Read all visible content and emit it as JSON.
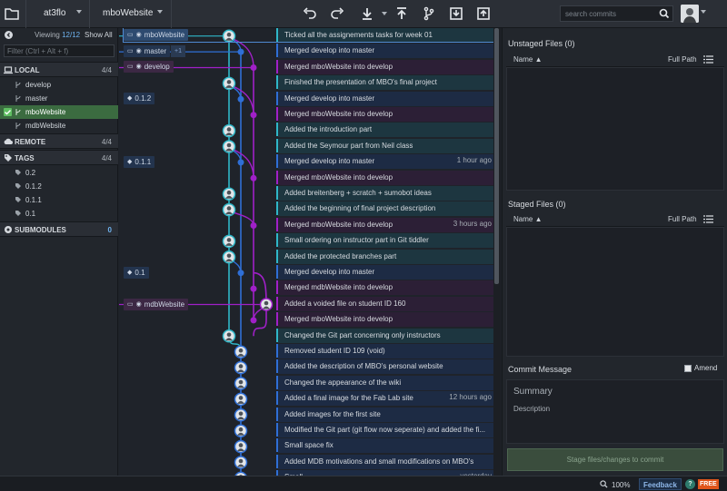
{
  "toolbar": {
    "repo_owner": "at3flo",
    "repo_name": "mboWebsite",
    "search_placeholder": "search commits",
    "actions": [
      "undo",
      "redo",
      "pull",
      "push",
      "branch",
      "stash",
      "pop"
    ]
  },
  "left_panel": {
    "viewing_label": "Viewing",
    "viewing_count": "12/12",
    "show_all": "Show All",
    "filter_placeholder": "Filter (Ctrl + Alt + f)",
    "local": {
      "label": "LOCAL",
      "count": "4/4",
      "items": [
        "develop",
        "master",
        "mboWebsite",
        "mdbWebsite"
      ],
      "active_index": 2
    },
    "remote": {
      "label": "REMOTE",
      "count": "4/4"
    },
    "tags": {
      "label": "TAGS",
      "count": "4/4",
      "items": [
        "0.2",
        "0.1.2",
        "0.1.1",
        "0.1"
      ]
    },
    "submodules": {
      "label": "SUBMODULES",
      "count": "0"
    }
  },
  "graph": {
    "branch_labels": {
      "mboWebsite": "mboWebsite",
      "master": "master",
      "master_extra": "+1",
      "develop": "develop",
      "tag_012": "0.1.2",
      "tag_011": "0.1.1",
      "tag_01": "0.1",
      "mdbWebsite": "mdbWebsite"
    },
    "commits": [
      {
        "msg": "Ticked all the assignements tasks for week 01",
        "time": ""
      },
      {
        "msg": "Merged develop into master",
        "time": ""
      },
      {
        "msg": "Merged mboWebsite into develop",
        "time": ""
      },
      {
        "msg": "Finished the presentation of MBO's final project",
        "time": ""
      },
      {
        "msg": "Merged develop into master",
        "time": ""
      },
      {
        "msg": "Merged mboWebsite into develop",
        "time": ""
      },
      {
        "msg": "Added the introduction part",
        "time": ""
      },
      {
        "msg": "Added the Seymour part from Neil class",
        "time": ""
      },
      {
        "msg": "Merged develop into master",
        "time": "1 hour ago"
      },
      {
        "msg": "Merged mboWebsite into develop",
        "time": ""
      },
      {
        "msg": "Added breitenberg + scratch + sumobot ideas",
        "time": ""
      },
      {
        "msg": "Added the beginning of final project description",
        "time": ""
      },
      {
        "msg": "Merged mboWebsite into develop",
        "time": "3 hours ago"
      },
      {
        "msg": "Small ordering on instructor part in Git tiddler",
        "time": ""
      },
      {
        "msg": "Added the protected branches part",
        "time": ""
      },
      {
        "msg": "Merged develop into master",
        "time": ""
      },
      {
        "msg": "Merged mdbWebsite into develop",
        "time": ""
      },
      {
        "msg": "Added a voided file on student ID 160",
        "time": ""
      },
      {
        "msg": "Merged mboWebsite into develop",
        "time": ""
      },
      {
        "msg": "Changed the Git part concerning only instructors",
        "time": ""
      },
      {
        "msg": "Removed student ID 109 (void)",
        "time": ""
      },
      {
        "msg": "Added the description of MBO's personal website",
        "time": ""
      },
      {
        "msg": "Changed the appearance of the wiki",
        "time": ""
      },
      {
        "msg": "Added a final image for the Fab Lab site",
        "time": "12 hours ago"
      },
      {
        "msg": "Added images for the first site",
        "time": ""
      },
      {
        "msg": "Modified the Git part (git flow now seperate) and added the fi...",
        "time": ""
      },
      {
        "msg": "Small space fix",
        "time": ""
      },
      {
        "msg": "Added MDB motivations and small modifications on MBO's",
        "time": ""
      },
      {
        "msg": "Small ...",
        "time": "yesterday"
      }
    ]
  },
  "right_panel": {
    "unstaged_title": "Unstaged Files (0)",
    "staged_title": "Staged Files (0)",
    "name_col": "Name",
    "full_path_col": "Full Path",
    "commit_message_label": "Commit Message",
    "amend_label": "Amend",
    "summary_placeholder": "Summary",
    "description_placeholder": "Description",
    "stage_button": "Stage files/changes to commit"
  },
  "status_bar": {
    "zoom": "100%",
    "feedback": "Feedback",
    "help": "?",
    "free": "FREE"
  },
  "colors": {
    "cyan_line": "#2fb7c8",
    "blue_line": "#2f6fd6",
    "purple_line": "#a020c8",
    "accent_blue": "#6fb4f0",
    "active_green": "#3b6b40"
  }
}
